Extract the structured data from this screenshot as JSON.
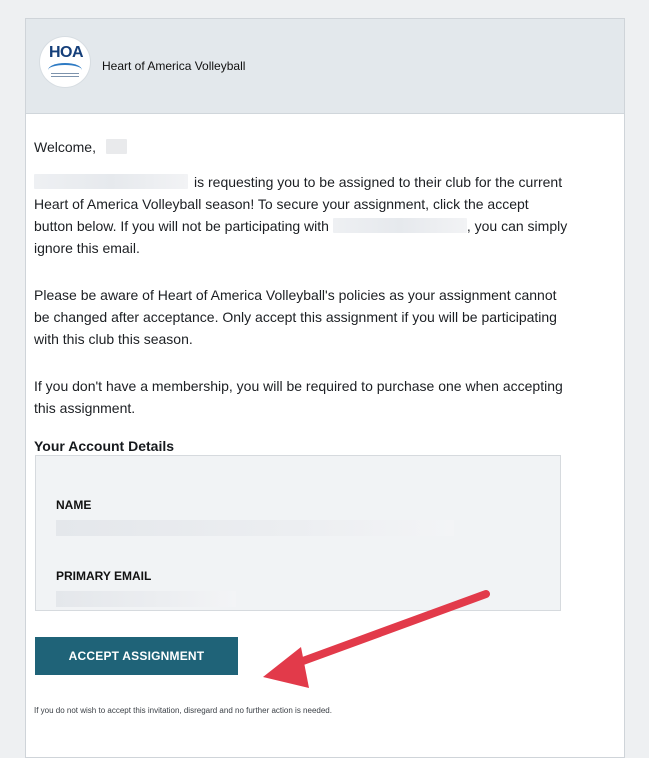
{
  "header": {
    "logo_alt": "HOA",
    "org_name": "Heart of America Volleyball"
  },
  "body": {
    "welcome": "Welcome,",
    "para1_a": "is requesting you to be assigned to their club for the current Heart of America Volleyball season! To secure your assignment, click the accept button below. If you will not be participating with",
    "para1_b": ", you can simply ignore this email.",
    "para2": "Please be aware of Heart of America Volleyball's policies as your assignment cannot be changed after acceptance. Only accept this assignment if you will be participating with this club this season.",
    "para3": "If you don't have a membership, you will be required to purchase one when accepting this assignment.",
    "account_title": "Your Account Details"
  },
  "details": {
    "name_label": "NAME",
    "email_label": "PRIMARY EMAIL"
  },
  "actions": {
    "accept_label": "ACCEPT ASSIGNMENT"
  },
  "footer": {
    "note": "If you do not wish to accept this invitation, disregard and no further action is needed."
  },
  "colors": {
    "button_bg": "#1f6378",
    "header_bg": "#e3e8ec",
    "arrow": "#e23a4a"
  }
}
